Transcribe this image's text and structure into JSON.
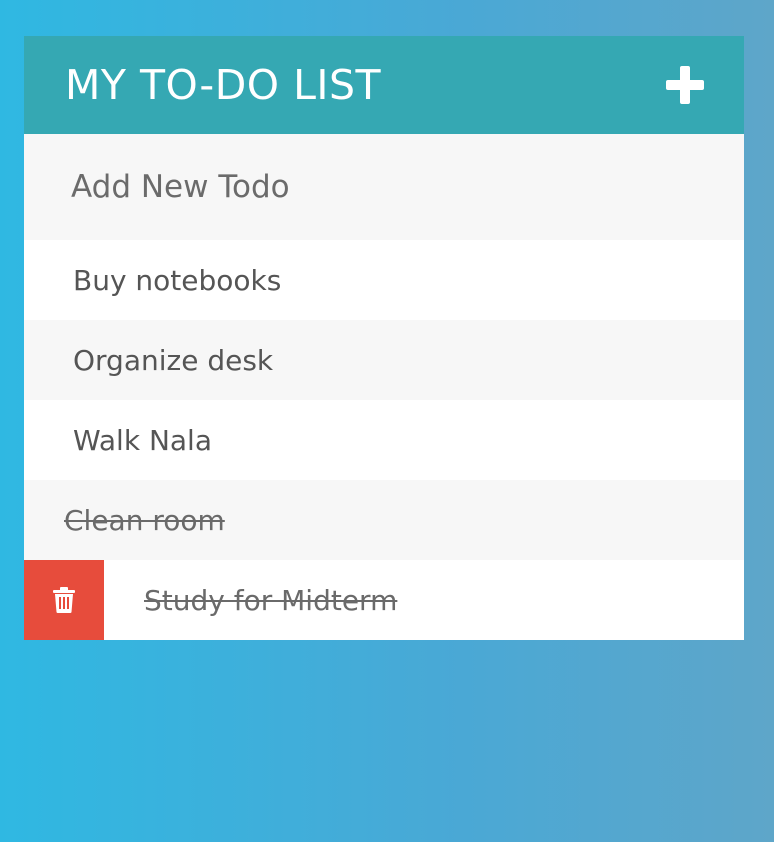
{
  "header": {
    "title": "MY TO-DO LIST",
    "add_icon": "plus-icon"
  },
  "new_todo": {
    "placeholder": "Add New Todo",
    "value": ""
  },
  "todos": [
    {
      "text": "Buy notebooks",
      "completed": false
    },
    {
      "text": "Organize desk",
      "completed": false
    },
    {
      "text": "Walk Nala",
      "completed": false
    },
    {
      "text": "Clean room",
      "completed": true
    },
    {
      "text": "Study for Midterm",
      "completed": true,
      "delete_icon": "trash-icon"
    }
  ],
  "colors": {
    "header": "#35a8b3",
    "delete": "#e74c3c",
    "text": "#555555"
  }
}
